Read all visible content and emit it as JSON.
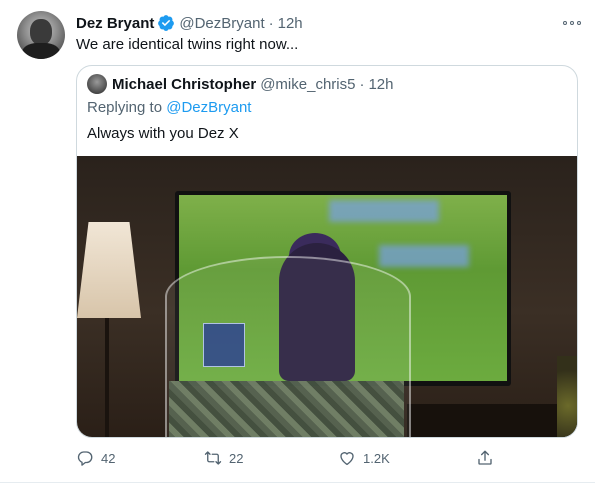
{
  "tweet": {
    "author_name": "Dez Bryant",
    "author_handle": "@DezBryant",
    "separator": "·",
    "time": "12h",
    "text": "We are identical twins right now...",
    "icons": {
      "verified": "verified-badge-icon",
      "more": "more-options-icon"
    }
  },
  "quote": {
    "author_name": "Michael Christopher",
    "author_handle": "@mike_chris5",
    "separator": "·",
    "time": "12h",
    "replying_prefix": "Replying to ",
    "replying_to": "@DezBryant",
    "text": "Always with you Dez X"
  },
  "actions": {
    "reply_count": "42",
    "retweet_count": "22",
    "like_count": "1.2K",
    "icons": [
      "reply-icon",
      "retweet-icon",
      "like-icon",
      "share-icon"
    ]
  },
  "colors": {
    "accent": "#1d9bf0",
    "secondary_text": "#536471",
    "primary_text": "#0f1419",
    "border": "#cfd9de"
  }
}
